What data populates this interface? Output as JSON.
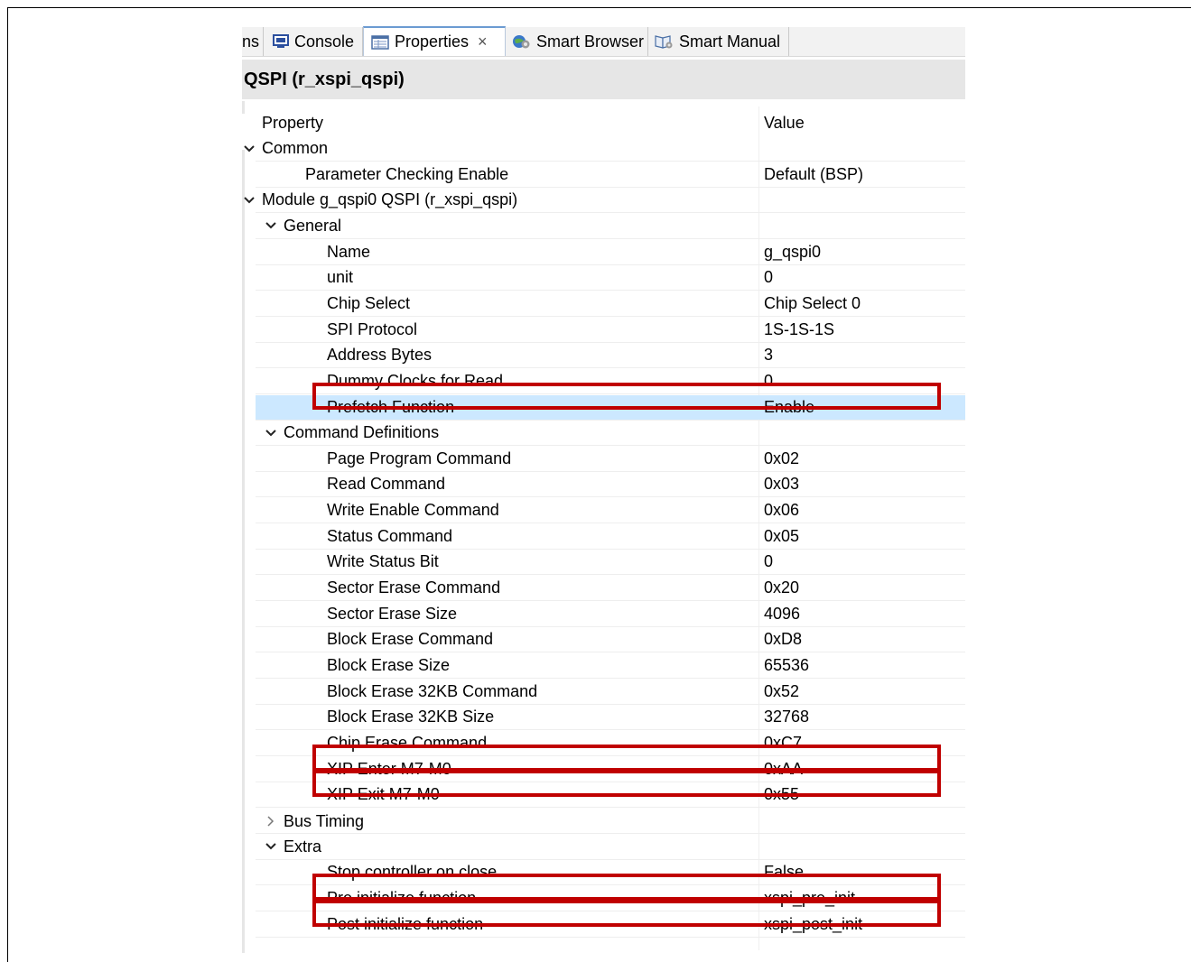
{
  "tabs": [
    {
      "label": "ns",
      "icon": "none"
    },
    {
      "label": "Console",
      "icon": "console-icon"
    },
    {
      "label": "Properties",
      "icon": "properties-icon",
      "close": "×"
    },
    {
      "label": "Smart Browser",
      "icon": "smart-browser-icon"
    },
    {
      "label": "Smart Manual",
      "icon": "smart-manual-icon"
    }
  ],
  "title": "QSPI (r_xspi_qspi)",
  "table": {
    "header_property": "Property",
    "header_value": "Value",
    "rows": [
      {
        "prop": "Common",
        "value": "",
        "expand": "expanded"
      },
      {
        "prop": "Parameter Checking Enable",
        "value": "Default (BSP)"
      },
      {
        "prop": "Module g_qspi0 QSPI (r_xspi_qspi)",
        "value": "",
        "expand": "expanded"
      },
      {
        "prop": "General",
        "value": "",
        "expand": "expanded"
      },
      {
        "prop": "Name",
        "value": "g_qspi0"
      },
      {
        "prop": "unit",
        "value": "0"
      },
      {
        "prop": "Chip Select",
        "value": "Chip Select 0"
      },
      {
        "prop": "SPI Protocol",
        "value": "1S-1S-1S"
      },
      {
        "prop": "Address Bytes",
        "value": "3"
      },
      {
        "prop": "Dummy Clocks for Read",
        "value": "0"
      },
      {
        "prop": "Prefetch Function",
        "value": "Enable",
        "selected": true
      },
      {
        "prop": "Command Definitions",
        "value": "",
        "expand": "expanded"
      },
      {
        "prop": "Page Program Command",
        "value": "0x02"
      },
      {
        "prop": "Read Command",
        "value": "0x03"
      },
      {
        "prop": "Write Enable Command",
        "value": "0x06"
      },
      {
        "prop": "Status Command",
        "value": "0x05"
      },
      {
        "prop": "Write Status Bit",
        "value": "0"
      },
      {
        "prop": "Sector Erase Command",
        "value": "0x20"
      },
      {
        "prop": "Sector Erase Size",
        "value": "4096"
      },
      {
        "prop": "Block Erase Command",
        "value": "0xD8"
      },
      {
        "prop": "Block Erase Size",
        "value": "65536"
      },
      {
        "prop": "Block Erase 32KB Command",
        "value": "0x52"
      },
      {
        "prop": "Block Erase 32KB Size",
        "value": "32768"
      },
      {
        "prop": "Chip Erase Command",
        "value": "0xC7"
      },
      {
        "prop": "XIP Enter M7-M0",
        "value": "0xAA"
      },
      {
        "prop": "XIP Exit M7-M0",
        "value": "0x55"
      },
      {
        "prop": "Bus Timing",
        "value": "",
        "expand": "collapsed"
      },
      {
        "prop": "Extra",
        "value": "",
        "expand": "expanded"
      },
      {
        "prop": "Stop controller on close",
        "value": "False"
      },
      {
        "prop": "Pre initialize function",
        "value": "xspi_pre_init"
      },
      {
        "prop": "Post initialize function",
        "value": "xspi_post_init"
      }
    ]
  },
  "highlighted_rows": [
    "Prefetch Function",
    "XIP Enter M7-M0",
    "XIP Exit M7-M0",
    "Pre initialize function",
    "Post initialize function"
  ],
  "colors": {
    "highlight_border": "#c00000",
    "selected_row": "#cce8ff",
    "title_bar": "#e6e6e6"
  }
}
